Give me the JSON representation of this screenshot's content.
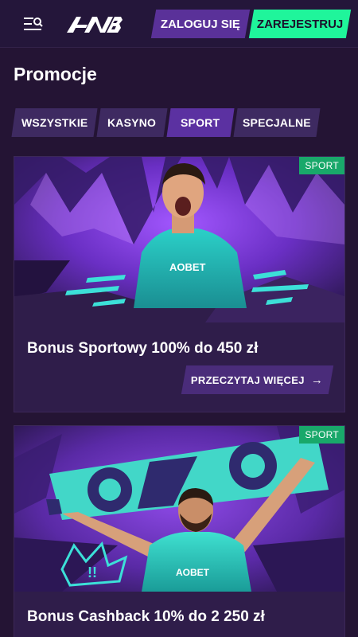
{
  "header": {
    "menu_icon": "search-menu-icon",
    "logo_icon": "brand-logo",
    "login_label": "ZALOGUJ SIĘ",
    "register_label": "ZAREJESTRUJ"
  },
  "page": {
    "title": "Promocje"
  },
  "tabs": [
    {
      "label": "WSZYSTKIE"
    },
    {
      "label": "KASYNO"
    },
    {
      "label": "SPORT",
      "active": true
    },
    {
      "label": "SPECJALNE"
    }
  ],
  "promotions": [
    {
      "badge": "SPORT",
      "title": "Bonus Sportowy 100% do 450 zł",
      "cta": "PRZECZYTAJ WIĘCEJ",
      "cta_icon": "arrow-right-icon",
      "shirt_text": "AOBET"
    },
    {
      "badge": "SPORT",
      "title": "Bonus Cashback 10% do 2 250 zł",
      "shirt_text": "AOBET"
    }
  ],
  "colors": {
    "background": "#241434",
    "accent_green": "#1ff59b",
    "accent_purple": "#5a3199",
    "badge_green": "#19a86a"
  }
}
